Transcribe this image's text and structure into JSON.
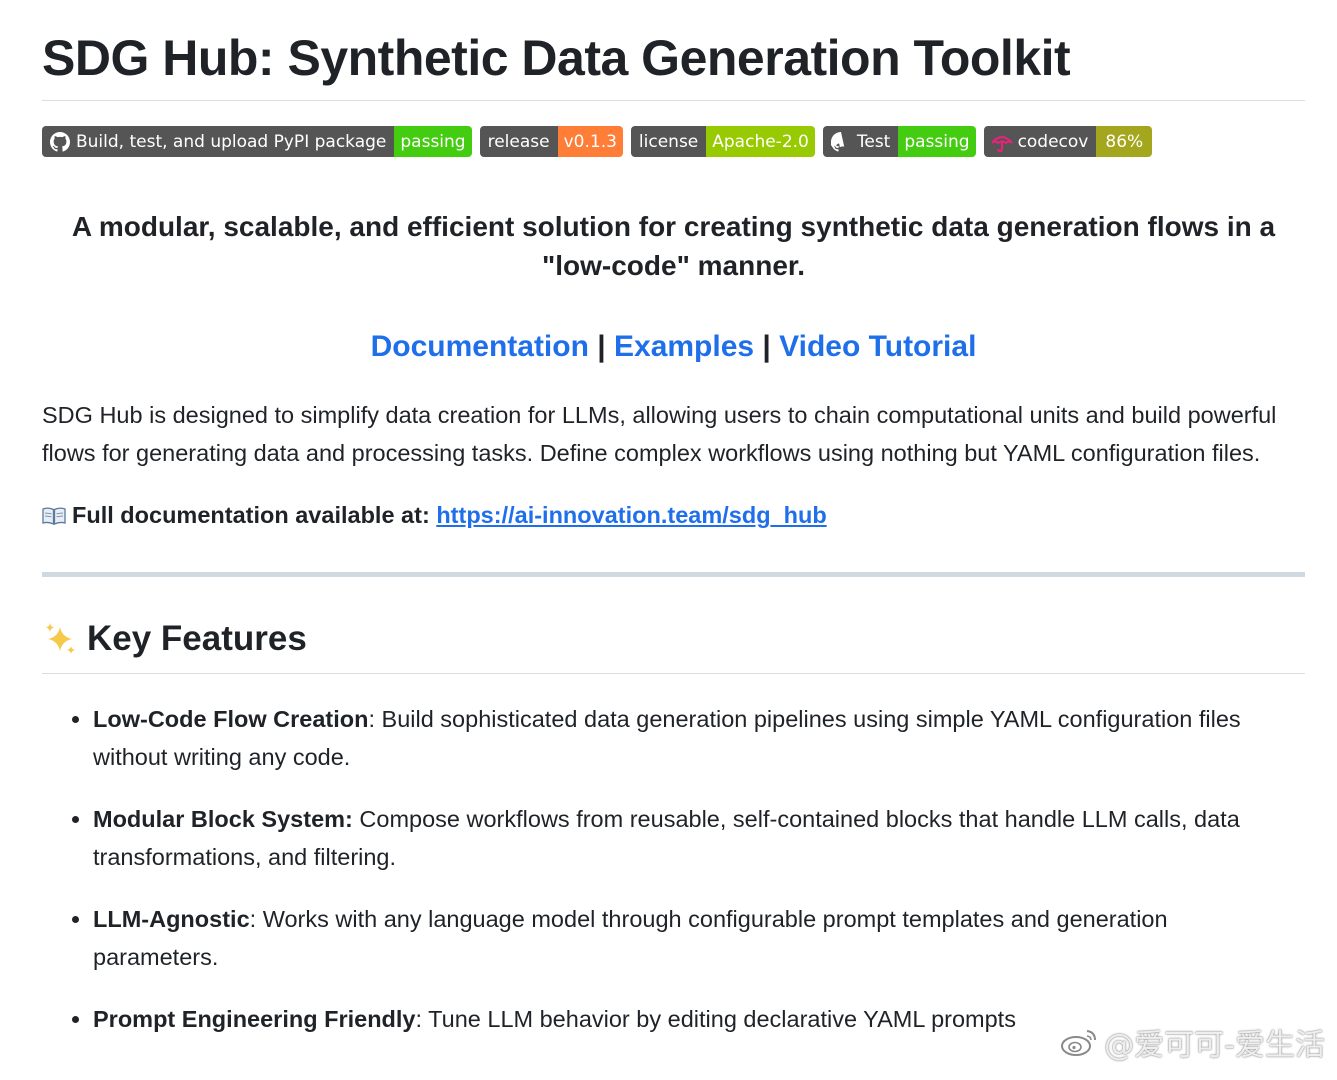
{
  "header": {
    "title": "SDG Hub: Synthetic Data Generation Toolkit"
  },
  "badges": [
    {
      "label": "Build, test, and upload PyPI package",
      "value": "passing",
      "icon": "github-icon",
      "color": "#4c1"
    },
    {
      "label": "release",
      "value": "v0.1.3",
      "icon": "",
      "color": "#fe7d37"
    },
    {
      "label": "license",
      "value": "Apache-2.0",
      "icon": "",
      "color": "#97ca00"
    },
    {
      "label": "Test",
      "value": "passing",
      "icon": "github-icon",
      "color": "#4c1"
    },
    {
      "label": "codecov",
      "value": "86%",
      "icon": "codecov-umbrella-icon",
      "color": "#a4a61d"
    }
  ],
  "tagline": "A modular, scalable, and efficient solution for creating synthetic data generation flows in a \"low-code\" manner.",
  "links": {
    "documentation": "Documentation",
    "examples": "Examples",
    "video": "Video Tutorial",
    "separator": " | "
  },
  "intro": "SDG Hub is designed to simplify data creation for LLMs, allowing users to chain computational units and build powerful flows for generating data and processing tasks. Define complex workflows using nothing but YAML configuration files.",
  "docs": {
    "icon": "open-book-icon",
    "label": "Full documentation available at:",
    "url_text": "https://ai-innovation.team/sdg_hub"
  },
  "features": {
    "icon": "sparkles-icon",
    "heading": "Key Features",
    "items": [
      {
        "name": "Low-Code Flow Creation",
        "desc": ": Build sophisticated data generation pipelines using simple YAML configuration files without writing any code."
      },
      {
        "name": "Modular Block System:",
        "desc": " Compose workflows from reusable, self-contained blocks that handle LLM calls, data transformations, and filtering."
      },
      {
        "name": "LLM-Agnostic",
        "desc": ": Works with any language model through configurable prompt templates and generation parameters."
      },
      {
        "name": "Prompt Engineering Friendly",
        "desc": ": Tune LLM behavior by editing declarative YAML prompts"
      }
    ]
  },
  "watermark": {
    "text": "@爱可可-爱生活",
    "icon": "weibo-logo-icon"
  }
}
